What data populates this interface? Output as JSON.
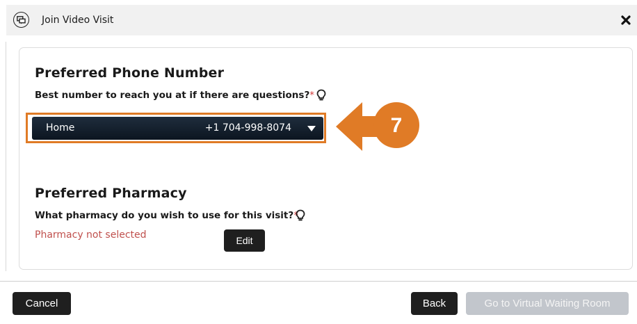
{
  "dialog": {
    "title": "Join Video Visit",
    "header_icon": "video-chat-icon",
    "close_icon": "close-icon"
  },
  "phone_section": {
    "title": "Preferred Phone Number",
    "question": "Best number to reach you at if there are questions?",
    "required_marker": "*",
    "hint_icon": "lightbulb-icon",
    "selected_type": "Home",
    "selected_number": "+1 704-998-8074",
    "dropdown_icon": "caret-down-icon",
    "highlight_color": "#e07b26"
  },
  "callout": {
    "number": "7",
    "color": "#e07b26",
    "direction": "left"
  },
  "pharmacy_section": {
    "title": "Preferred Pharmacy",
    "question": "What pharmacy do you wish to use for this visit?",
    "required_marker": "*",
    "hint_icon": "lightbulb-icon",
    "status": "Pharmacy not selected",
    "edit_label": "Edit"
  },
  "footer": {
    "cancel_label": "Cancel",
    "back_label": "Back",
    "waiting_room_label": "Go to Virtual Waiting Room"
  }
}
